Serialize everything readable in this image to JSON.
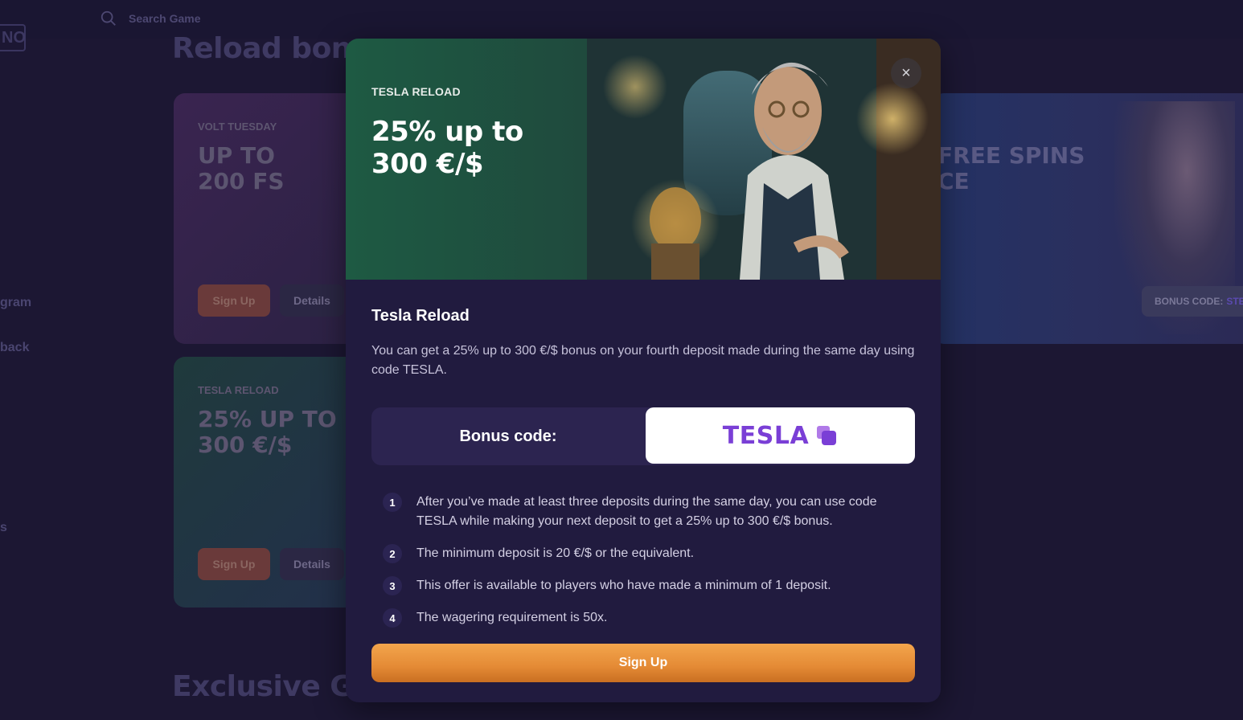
{
  "header": {
    "logo_fragment": "NO",
    "search_placeholder": "Search Game"
  },
  "sidebar": {
    "items": [
      {
        "label": "gram"
      },
      {
        "label": "back"
      },
      {
        "label": "s"
      }
    ]
  },
  "background": {
    "section_title_top": "Reload bonuses",
    "section_title_bottom": "Exclusive G",
    "cards": [
      {
        "kicker": "VOLT TUESDAY",
        "headline": "UP TO\n200 FS",
        "signup": "Sign Up",
        "details": "Details"
      },
      {
        "kicker": "TESLA RELOAD",
        "headline": "25% UP TO\n300 €/$",
        "signup": "Sign Up",
        "details": "Details"
      }
    ],
    "right_card": {
      "headline": "FREE SPINS\nCE",
      "code_label": "BONUS CODE:",
      "code_value": "STE"
    }
  },
  "modal": {
    "hero_kicker": "TESLA RELOAD",
    "hero_title": "25% up to\n300 €/$",
    "close_label": "×",
    "title": "Tesla Reload",
    "description": "You can get a 25% up to 300 €/$ bonus on your fourth deposit made during the same day using code TESLA.",
    "bonus_code_label": "Bonus code:",
    "bonus_code": "TESLA",
    "steps": [
      {
        "num": "1",
        "text": "After you’ve made at least three deposits during the same day, you can use code TESLA while making your next deposit to get a 25% up to 300 €/$ bonus."
      },
      {
        "num": "2",
        "text": "The minimum deposit is 20 €/$ or the equivalent."
      },
      {
        "num": "3",
        "text": "This offer is available to players who have made a minimum of 1 deposit."
      },
      {
        "num": "4",
        "text": "The wagering requirement is 50x."
      }
    ],
    "signup_label": "Sign Up"
  },
  "colors": {
    "page_bg": "#1c1733",
    "modal_bg": "#211b3f",
    "hero_green": "#1e5a43",
    "code_purple": "#7a3fd6",
    "signup_orange": "#e48a35"
  },
  "icons": {
    "search": "search-icon",
    "close": "close-icon",
    "copy": "copy-icon"
  }
}
